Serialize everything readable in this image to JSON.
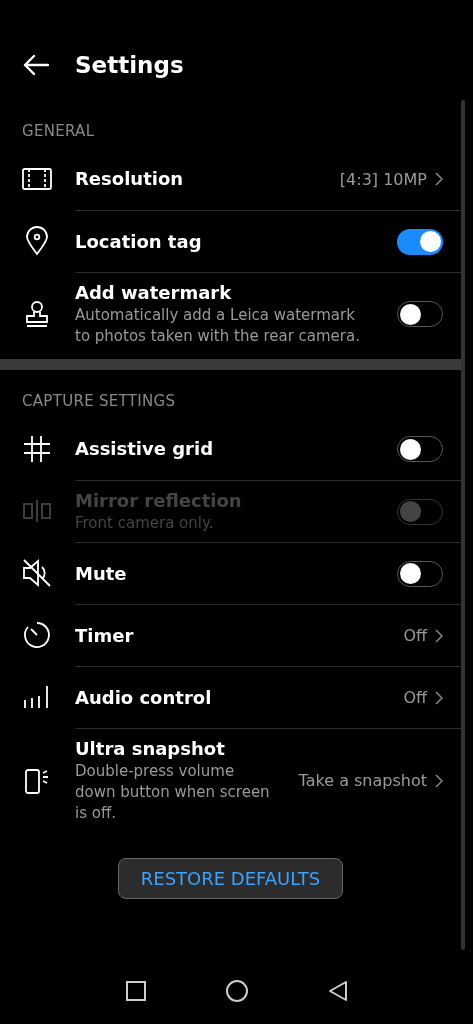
{
  "header": {
    "title": "Settings"
  },
  "sections": [
    {
      "title": "GENERAL",
      "items": [
        {
          "kind": "link",
          "title": "Resolution",
          "value": "[4:3] 10MP",
          "disabled": false
        },
        {
          "kind": "toggle",
          "title": "Location tag",
          "on": true,
          "disabled": false
        },
        {
          "kind": "toggle",
          "title": "Add watermark",
          "subtitle": "Automatically add a Leica watermark to photos taken with the rear camera.",
          "on": false,
          "disabled": false
        }
      ]
    },
    {
      "title": "CAPTURE SETTINGS",
      "items": [
        {
          "kind": "toggle",
          "title": "Assistive grid",
          "on": false,
          "disabled": false
        },
        {
          "kind": "toggle",
          "title": "Mirror reflection",
          "subtitle": "Front camera only.",
          "on": false,
          "disabled": true
        },
        {
          "kind": "toggle",
          "title": "Mute",
          "on": false,
          "disabled": false
        },
        {
          "kind": "link",
          "title": "Timer",
          "value": "Off",
          "disabled": false
        },
        {
          "kind": "link",
          "title": "Audio control",
          "value": "Off",
          "disabled": false
        },
        {
          "kind": "link",
          "title": "Ultra snapshot",
          "subtitle": "Double-press volume down button when screen is off.",
          "value": "Take a snapshot",
          "disabled": false
        }
      ]
    }
  ],
  "restore_button": "RESTORE DEFAULTS"
}
